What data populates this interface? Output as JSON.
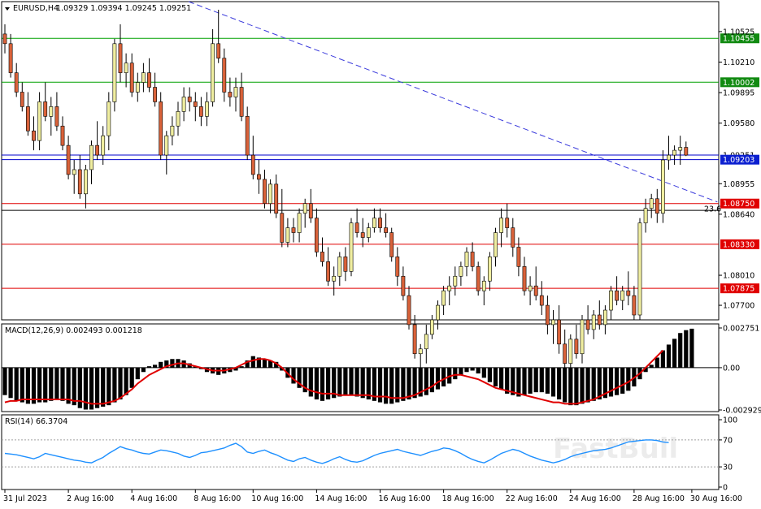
{
  "chart_data": {
    "type": "candlestick",
    "symbol_label": "EURUSD,H4",
    "ohlc_label": "1.09329 1.09394 1.09245 1.09251",
    "watermark": "FastBull",
    "colors": {
      "bull": "#f0eea0",
      "bear": "#d9623a",
      "wick": "#000000",
      "green_line": "#00a000",
      "blue_line": "#0000cc",
      "red_line": "#e00000",
      "trend_line": "#3a3adc",
      "macd_signal": "#e00000",
      "rsi": "#1e90ff",
      "label_green_bg": "#118a11",
      "label_blue_bg": "#0b1fd0",
      "label_red_bg": "#e00000"
    },
    "price_panel": {
      "ylim": [
        1.0765,
        1.0586
      ],
      "tick_labels": [
        "1.10525",
        "1.10210",
        "1.09895",
        "1.09580",
        "1.08955",
        "1.08640",
        "1.08010",
        "1.07700"
      ],
      "tick_values": [
        1.10525,
        1.1021,
        1.09895,
        1.0958,
        1.08955,
        1.0864,
        1.0801,
        1.077
      ],
      "levels": [
        {
          "label": "1.10455",
          "value": 1.10455,
          "style": "green"
        },
        {
          "label": "1.10002",
          "value": 1.10002,
          "style": "green"
        },
        {
          "label": "1.09251",
          "value": 1.09251,
          "style": "current"
        },
        {
          "label": "1.09203",
          "value": 1.09203,
          "style": "blue"
        },
        {
          "label": "1.08750",
          "value": 1.0875,
          "style": "red"
        },
        {
          "label": "",
          "value": 1.0868,
          "style": "black"
        },
        {
          "label": "1.08330",
          "value": 1.0833,
          "style": "red"
        },
        {
          "label": "1.07875",
          "value": 1.07875,
          "style": "red"
        }
      ],
      "fib_label": "23.6",
      "trendline": {
        "from": [
          0,
          1.1097
        ],
        "to": [
          123,
          1.0875
        ]
      }
    },
    "x_labels": [
      "31 Jul 2023",
      "2 Aug 16:00",
      "4 Aug 16:00",
      "8 Aug 16:00",
      "10 Aug 16:00",
      "14 Aug 16:00",
      "16 Aug 16:00",
      "18 Aug 16:00",
      "22 Aug 16:00",
      "24 Aug 16:00",
      "28 Aug 16:00",
      "30 Aug 16:00"
    ],
    "x_label_index": [
      0,
      11,
      22,
      33,
      43,
      54,
      65,
      76,
      87,
      98,
      109,
      119
    ],
    "macd": {
      "label": "MACD(12,26,9) 0.002493 0.001218",
      "tick_labels": [
        "0.002751",
        "0.00",
        "-0.002929"
      ],
      "tick_values": [
        0.002751,
        0.0,
        -0.002929
      ],
      "histogram": [
        -0.0019,
        -0.0021,
        -0.0023,
        -0.0024,
        -0.0025,
        -0.0025,
        -0.0024,
        -0.0024,
        -0.0023,
        -0.0022,
        -0.0023,
        -0.0025,
        -0.0026,
        -0.0028,
        -0.0029,
        -0.0029,
        -0.0028,
        -0.0027,
        -0.0026,
        -0.0024,
        -0.0022,
        -0.0019,
        -0.0014,
        -0.0008,
        -0.0003,
        0.0001,
        0.0002,
        0.0004,
        0.0005,
        0.0006,
        0.0006,
        0.0005,
        0.0003,
        0.0001,
        -0.0001,
        -0.0003,
        -0.0004,
        -0.0005,
        -0.0004,
        -0.0003,
        -0.0002,
        0.0001,
        0.0005,
        0.0008,
        0.0007,
        0.0006,
        0.0005,
        0.0004,
        -0.0002,
        -0.0007,
        -0.0011,
        -0.0014,
        -0.0017,
        -0.002,
        -0.0022,
        -0.0023,
        -0.0022,
        -0.0021,
        -0.002,
        -0.0019,
        -0.0019,
        -0.002,
        -0.0021,
        -0.0022,
        -0.0023,
        -0.0024,
        -0.0025,
        -0.0025,
        -0.0024,
        -0.0023,
        -0.0022,
        -0.0021,
        -0.002,
        -0.0019,
        -0.0017,
        -0.0015,
        -0.0013,
        -0.0011,
        -0.0008,
        -0.0005,
        -0.0003,
        -0.0002,
        -0.0004,
        -0.0007,
        -0.001,
        -0.0013,
        -0.0015,
        -0.0018,
        -0.0019,
        -0.002,
        -0.0019,
        -0.0018,
        -0.0017,
        -0.0017,
        -0.0018,
        -0.002,
        -0.0022,
        -0.0024,
        -0.0026,
        -0.0026,
        -0.0025,
        -0.0024,
        -0.0023,
        -0.0022,
        -0.0021,
        -0.002,
        -0.0019,
        -0.0018,
        -0.0016,
        -0.0013,
        -0.0008,
        -0.0003,
        0.0002,
        0.0007,
        0.0012,
        0.0016,
        0.002,
        0.0024,
        0.0026,
        0.0027
      ],
      "signal": [
        -0.0024,
        -0.0023,
        -0.0023,
        -0.0022,
        -0.0022,
        -0.0022,
        -0.0022,
        -0.0022,
        -0.0022,
        -0.0022,
        -0.0022,
        -0.0022,
        -0.0023,
        -0.0023,
        -0.0024,
        -0.0025,
        -0.0025,
        -0.0025,
        -0.0024,
        -0.0023,
        -0.0021,
        -0.0018,
        -0.0015,
        -0.0011,
        -0.0008,
        -0.0005,
        -0.0003,
        -0.0001,
        0.0001,
        0.0002,
        0.0003,
        0.0003,
        0.0002,
        0.0001,
        0.0,
        -0.0001,
        -0.0002,
        -0.0002,
        -0.0002,
        -0.0001,
        0.0,
        0.0002,
        0.0004,
        0.0005,
        0.0006,
        0.0006,
        0.0005,
        0.0003,
        0.0,
        -0.0004,
        -0.0008,
        -0.0011,
        -0.0014,
        -0.0016,
        -0.0017,
        -0.0018,
        -0.0018,
        -0.0018,
        -0.0019,
        -0.0019,
        -0.0019,
        -0.0019,
        -0.0019,
        -0.0019,
        -0.002,
        -0.002,
        -0.002,
        -0.0021,
        -0.0021,
        -0.0021,
        -0.002,
        -0.0019,
        -0.0017,
        -0.0015,
        -0.0013,
        -0.001,
        -0.0008,
        -0.0006,
        -0.0005,
        -0.0005,
        -0.0006,
        -0.0007,
        -0.0008,
        -0.001,
        -0.0012,
        -0.0014,
        -0.0015,
        -0.0016,
        -0.0017,
        -0.0018,
        -0.0019,
        -0.002,
        -0.0021,
        -0.0022,
        -0.0023,
        -0.0024,
        -0.0024,
        -0.0025,
        -0.0025,
        -0.0025,
        -0.0024,
        -0.0023,
        -0.0022,
        -0.002,
        -0.0018,
        -0.0016,
        -0.0014,
        -0.0012,
        -0.001,
        -0.0007,
        -0.0004,
        0.0,
        0.0004,
        0.0008,
        0.0012
      ],
      "ylim": [
        -0.002929,
        0.002751
      ]
    },
    "rsi": {
      "label": "RSI(14) 66.3704",
      "tick_labels": [
        "100",
        "70",
        "30",
        "0"
      ],
      "tick_values": [
        100,
        70,
        30,
        0
      ],
      "ylim": [
        0,
        100
      ],
      "values": [
        50,
        49,
        48,
        46,
        44,
        42,
        45,
        50,
        48,
        46,
        44,
        42,
        40,
        39,
        37,
        36,
        40,
        44,
        50,
        55,
        60,
        57,
        55,
        52,
        50,
        49,
        52,
        55,
        54,
        52,
        50,
        46,
        44,
        47,
        51,
        52,
        54,
        56,
        58,
        62,
        65,
        60,
        52,
        50,
        53,
        55,
        51,
        48,
        44,
        40,
        38,
        42,
        44,
        40,
        37,
        35,
        38,
        42,
        45,
        41,
        38,
        37,
        39,
        43,
        47,
        50,
        52,
        54,
        56,
        53,
        51,
        49,
        47,
        50,
        53,
        55,
        58,
        57,
        54,
        50,
        45,
        41,
        38,
        36,
        40,
        45,
        50,
        53,
        56,
        54,
        50,
        46,
        43,
        40,
        38,
        36,
        38,
        41,
        45,
        48,
        50,
        52,
        54,
        55,
        56,
        58,
        61,
        64,
        67,
        68,
        69,
        70,
        70,
        69,
        67,
        66
      ],
      "guide_levels": [
        70,
        30
      ]
    },
    "candles": [
      [
        1.105,
        1.106,
        1.103,
        1.104
      ],
      [
        1.104,
        1.105,
        1.1005,
        1.101
      ],
      [
        1.101,
        1.102,
        1.0985,
        1.099
      ],
      [
        1.099,
        1.1,
        1.097,
        1.0975
      ],
      [
        1.0975,
        1.099,
        1.0945,
        1.095
      ],
      [
        1.095,
        1.0965,
        1.093,
        1.094
      ],
      [
        1.094,
        1.099,
        1.093,
        1.098
      ],
      [
        1.098,
        1.1,
        1.096,
        1.0965
      ],
      [
        1.0965,
        1.0985,
        1.0945,
        1.0975
      ],
      [
        1.0975,
        1.099,
        1.095,
        1.0955
      ],
      [
        1.0955,
        1.0965,
        1.093,
        1.0935
      ],
      [
        1.0935,
        1.0945,
        1.09,
        1.0905
      ],
      [
        1.0905,
        1.092,
        1.0885,
        1.091
      ],
      [
        1.091,
        1.0925,
        1.088,
        1.0885
      ],
      [
        1.0885,
        1.0915,
        1.087,
        1.091
      ],
      [
        1.091,
        1.094,
        1.0895,
        1.0935
      ],
      [
        1.0935,
        1.096,
        1.092,
        1.0925
      ],
      [
        1.0925,
        1.0955,
        1.0915,
        1.0945
      ],
      [
        1.0945,
        1.099,
        1.093,
        1.098
      ],
      [
        1.098,
        1.1045,
        1.097,
        1.104
      ],
      [
        1.104,
        1.106,
        1.1,
        1.101
      ],
      [
        1.101,
        1.103,
        1.0995,
        1.102
      ],
      [
        1.102,
        1.103,
        1.0985,
        1.099
      ],
      [
        1.099,
        1.101,
        1.098,
        1.1
      ],
      [
        1.1,
        1.102,
        1.099,
        1.101
      ],
      [
        1.101,
        1.1025,
        1.099,
        1.0995
      ],
      [
        1.0995,
        1.101,
        1.0975,
        1.098
      ],
      [
        1.098,
        1.099,
        1.092,
        1.0925
      ],
      [
        1.0925,
        1.095,
        1.0905,
        1.0945
      ],
      [
        1.0945,
        1.0965,
        1.0935,
        1.0955
      ],
      [
        1.0955,
        1.098,
        1.0945,
        1.097
      ],
      [
        1.097,
        1.0995,
        1.096,
        1.0985
      ],
      [
        1.0985,
        1.0995,
        1.097,
        1.098
      ],
      [
        1.098,
        1.099,
        1.096,
        1.0975
      ],
      [
        1.0975,
        1.0985,
        1.0955,
        1.0965
      ],
      [
        1.0965,
        1.099,
        1.0955,
        1.098
      ],
      [
        1.098,
        1.1055,
        1.0975,
        1.104
      ],
      [
        1.104,
        1.1075,
        1.102,
        1.1025
      ],
      [
        1.1025,
        1.1035,
        1.098,
        1.099
      ],
      [
        1.099,
        1.1005,
        1.0975,
        1.0985
      ],
      [
        1.0985,
        1.1005,
        1.097,
        1.0995
      ],
      [
        1.0995,
        1.101,
        1.096,
        1.0965
      ],
      [
        1.0965,
        1.0975,
        1.092,
        1.0925
      ],
      [
        1.0925,
        1.0945,
        1.09,
        1.0905
      ],
      [
        1.0905,
        1.092,
        1.0885,
        1.09
      ],
      [
        1.09,
        1.091,
        1.087,
        1.0875
      ],
      [
        1.0875,
        1.09,
        1.0865,
        1.0895
      ],
      [
        1.0895,
        1.0905,
        1.086,
        1.0865
      ],
      [
        1.0865,
        1.089,
        1.083,
        1.0835
      ],
      [
        1.0835,
        1.086,
        1.083,
        1.085
      ],
      [
        1.085,
        1.086,
        1.0835,
        1.0845
      ],
      [
        1.0845,
        1.087,
        1.0835,
        1.0865
      ],
      [
        1.0865,
        1.088,
        1.085,
        1.0875
      ],
      [
        1.0875,
        1.089,
        1.0855,
        1.086
      ],
      [
        1.086,
        1.087,
        1.082,
        1.0825
      ],
      [
        1.0825,
        1.084,
        1.081,
        1.0815
      ],
      [
        1.0815,
        1.083,
        1.079,
        1.0795
      ],
      [
        1.0795,
        1.081,
        1.078,
        1.08
      ],
      [
        1.08,
        1.0825,
        1.079,
        1.082
      ],
      [
        1.082,
        1.083,
        1.0795,
        1.0805
      ],
      [
        1.0805,
        1.086,
        1.08,
        1.0855
      ],
      [
        1.0855,
        1.087,
        1.084,
        1.0845
      ],
      [
        1.0845,
        1.086,
        1.083,
        1.084
      ],
      [
        1.084,
        1.0855,
        1.0835,
        1.085
      ],
      [
        1.085,
        1.087,
        1.0845,
        1.086
      ],
      [
        1.086,
        1.087,
        1.0845,
        1.085
      ],
      [
        1.085,
        1.0865,
        1.084,
        1.0845
      ],
      [
        1.0845,
        1.085,
        1.0815,
        1.082
      ],
      [
        1.082,
        1.083,
        1.079,
        1.08
      ],
      [
        1.08,
        1.081,
        1.0775,
        1.078
      ],
      [
        1.078,
        1.079,
        1.0745,
        1.075
      ],
      [
        1.075,
        1.076,
        1.0715,
        1.072
      ],
      [
        1.072,
        1.073,
        1.07,
        1.0725
      ],
      [
        1.0725,
        1.075,
        1.071,
        1.074
      ],
      [
        1.074,
        1.076,
        1.0735,
        1.0755
      ],
      [
        1.0755,
        1.0775,
        1.0745,
        1.077
      ],
      [
        1.077,
        1.079,
        1.076,
        1.0785
      ],
      [
        1.0785,
        1.08,
        1.077,
        1.079
      ],
      [
        1.079,
        1.081,
        1.078,
        1.08
      ],
      [
        1.08,
        1.0815,
        1.079,
        1.081
      ],
      [
        1.081,
        1.083,
        1.08,
        1.0825
      ],
      [
        1.0825,
        1.0835,
        1.0805,
        1.081
      ],
      [
        1.081,
        1.0815,
        1.078,
        1.0785
      ],
      [
        1.0785,
        1.08,
        1.077,
        1.0795
      ],
      [
        1.0795,
        1.0825,
        1.0785,
        1.082
      ],
      [
        1.082,
        1.085,
        1.081,
        1.0845
      ],
      [
        1.0845,
        1.087,
        1.083,
        1.086
      ],
      [
        1.086,
        1.0875,
        1.084,
        1.085
      ],
      [
        1.085,
        1.086,
        1.082,
        1.083
      ],
      [
        1.083,
        1.084,
        1.08,
        1.081
      ],
      [
        1.081,
        1.082,
        1.078,
        1.0785
      ],
      [
        1.0785,
        1.08,
        1.077,
        1.079
      ],
      [
        1.079,
        1.081,
        1.0775,
        1.078
      ],
      [
        1.078,
        1.0795,
        1.076,
        1.077
      ],
      [
        1.077,
        1.078,
        1.074,
        1.075
      ],
      [
        1.075,
        1.0765,
        1.073,
        1.0755
      ],
      [
        1.0755,
        1.077,
        1.072,
        1.073
      ],
      [
        1.073,
        1.0745,
        1.07,
        1.071
      ],
      [
        1.071,
        1.074,
        1.0705,
        1.0735
      ],
      [
        1.0735,
        1.075,
        1.0715,
        1.072
      ],
      [
        1.072,
        1.076,
        1.071,
        1.0755
      ],
      [
        1.0755,
        1.077,
        1.074,
        1.0745
      ],
      [
        1.0745,
        1.0765,
        1.0735,
        1.076
      ],
      [
        1.076,
        1.0775,
        1.0745,
        1.075
      ],
      [
        1.075,
        1.077,
        1.074,
        1.0765
      ],
      [
        1.0765,
        1.079,
        1.0755,
        1.0785
      ],
      [
        1.0785,
        1.08,
        1.077,
        1.0775
      ],
      [
        1.0775,
        1.079,
        1.0765,
        1.0785
      ],
      [
        1.0785,
        1.0805,
        1.077,
        1.078
      ],
      [
        1.078,
        1.079,
        1.0755,
        1.076
      ],
      [
        1.076,
        1.086,
        1.0755,
        1.0855
      ],
      [
        1.0855,
        1.088,
        1.0845,
        1.087
      ],
      [
        1.087,
        1.0885,
        1.086,
        1.088
      ],
      [
        1.088,
        1.089,
        1.0855,
        1.0865
      ],
      [
        1.0865,
        1.093,
        1.0855,
        1.092
      ],
      [
        1.092,
        1.0945,
        1.091,
        1.0925
      ],
      [
        1.0925,
        1.0935,
        1.0915,
        1.093
      ],
      [
        1.093,
        1.0945,
        1.0915,
        1.0933
      ],
      [
        1.0933,
        1.0939,
        1.0924,
        1.0925
      ]
    ]
  }
}
